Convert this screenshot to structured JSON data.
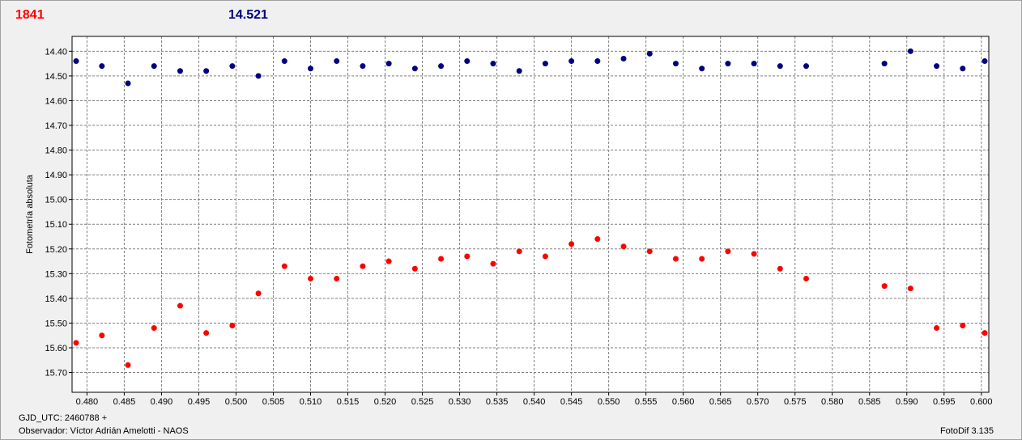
{
  "header": {
    "left_label": "1841",
    "right_label": "14.521",
    "left_color": "#ff0000",
    "right_color": "#000080"
  },
  "footer": {
    "jd_label": "GJD_UTC: 2460788 +",
    "observer": "Observador: Víctor Adrián Amelotti - NAOS",
    "software": "FotoDif 3.135"
  },
  "chart_data": {
    "type": "scatter",
    "title": "",
    "xlabel": "",
    "ylabel": "Fotometría absoluta",
    "xlim": [
      0.478,
      0.601
    ],
    "ylim": [
      15.78,
      14.34
    ],
    "y_inverted": true,
    "grid": true,
    "x_ticks": [
      "0.480",
      "0.485",
      "0.490",
      "0.495",
      "0.500",
      "0.505",
      "0.510",
      "0.515",
      "0.520",
      "0.525",
      "0.530",
      "0.535",
      "0.540",
      "0.545",
      "0.550",
      "0.555",
      "0.560",
      "0.565",
      "0.570",
      "0.575",
      "0.580",
      "0.585",
      "0.590",
      "0.595",
      "0.600"
    ],
    "y_ticks": [
      "14.40",
      "14.50",
      "14.60",
      "14.70",
      "14.80",
      "14.90",
      "15.00",
      "15.10",
      "15.20",
      "15.30",
      "15.40",
      "15.50",
      "15.60",
      "15.70"
    ],
    "series": [
      {
        "color": "#ff0000",
        "x": [
          0.4785,
          0.482,
          0.4855,
          0.489,
          0.4925,
          0.496,
          0.4995,
          0.503,
          0.5065,
          0.51,
          0.5135,
          0.517,
          0.5205,
          0.524,
          0.5275,
          0.531,
          0.5345,
          0.538,
          0.5415,
          0.545,
          0.5485,
          0.552,
          0.5555,
          0.559,
          0.5625,
          0.566,
          0.5695,
          0.573,
          0.5765,
          0.587,
          0.5905,
          0.594,
          0.5975,
          0.601
        ],
        "y": [
          15.58,
          15.55,
          15.67,
          15.52,
          15.43,
          15.54,
          15.51,
          15.38,
          15.27,
          15.32,
          15.32,
          15.27,
          15.25,
          15.28,
          15.24,
          15.23,
          15.26,
          15.21,
          15.23,
          15.18,
          15.16,
          15.19,
          15.21,
          15.24,
          15.24,
          15.21,
          15.22,
          15.28,
          15.32,
          15.35,
          15.36,
          15.52,
          15.51,
          15.54
        ]
      },
      {
        "color": "#000080",
        "x": [
          0.4785,
          0.482,
          0.4855,
          0.489,
          0.4925,
          0.496,
          0.4995,
          0.503,
          0.5065,
          0.51,
          0.5135,
          0.517,
          0.5205,
          0.524,
          0.5275,
          0.531,
          0.5345,
          0.538,
          0.5415,
          0.545,
          0.5485,
          0.552,
          0.5555,
          0.559,
          0.5625,
          0.566,
          0.5695,
          0.573,
          0.5765,
          0.587,
          0.5905,
          0.594,
          0.5975,
          0.601
        ],
        "y": [
          14.44,
          14.46,
          14.53,
          14.46,
          14.48,
          14.48,
          14.46,
          14.5,
          14.44,
          14.47,
          14.44,
          14.46,
          14.45,
          14.47,
          14.46,
          14.44,
          14.45,
          14.48,
          14.45,
          14.44,
          14.44,
          14.43,
          14.41,
          14.45,
          14.47,
          14.45,
          14.45,
          14.46,
          14.46,
          14.45,
          14.4,
          14.46,
          14.47,
          14.44
        ]
      }
    ]
  }
}
